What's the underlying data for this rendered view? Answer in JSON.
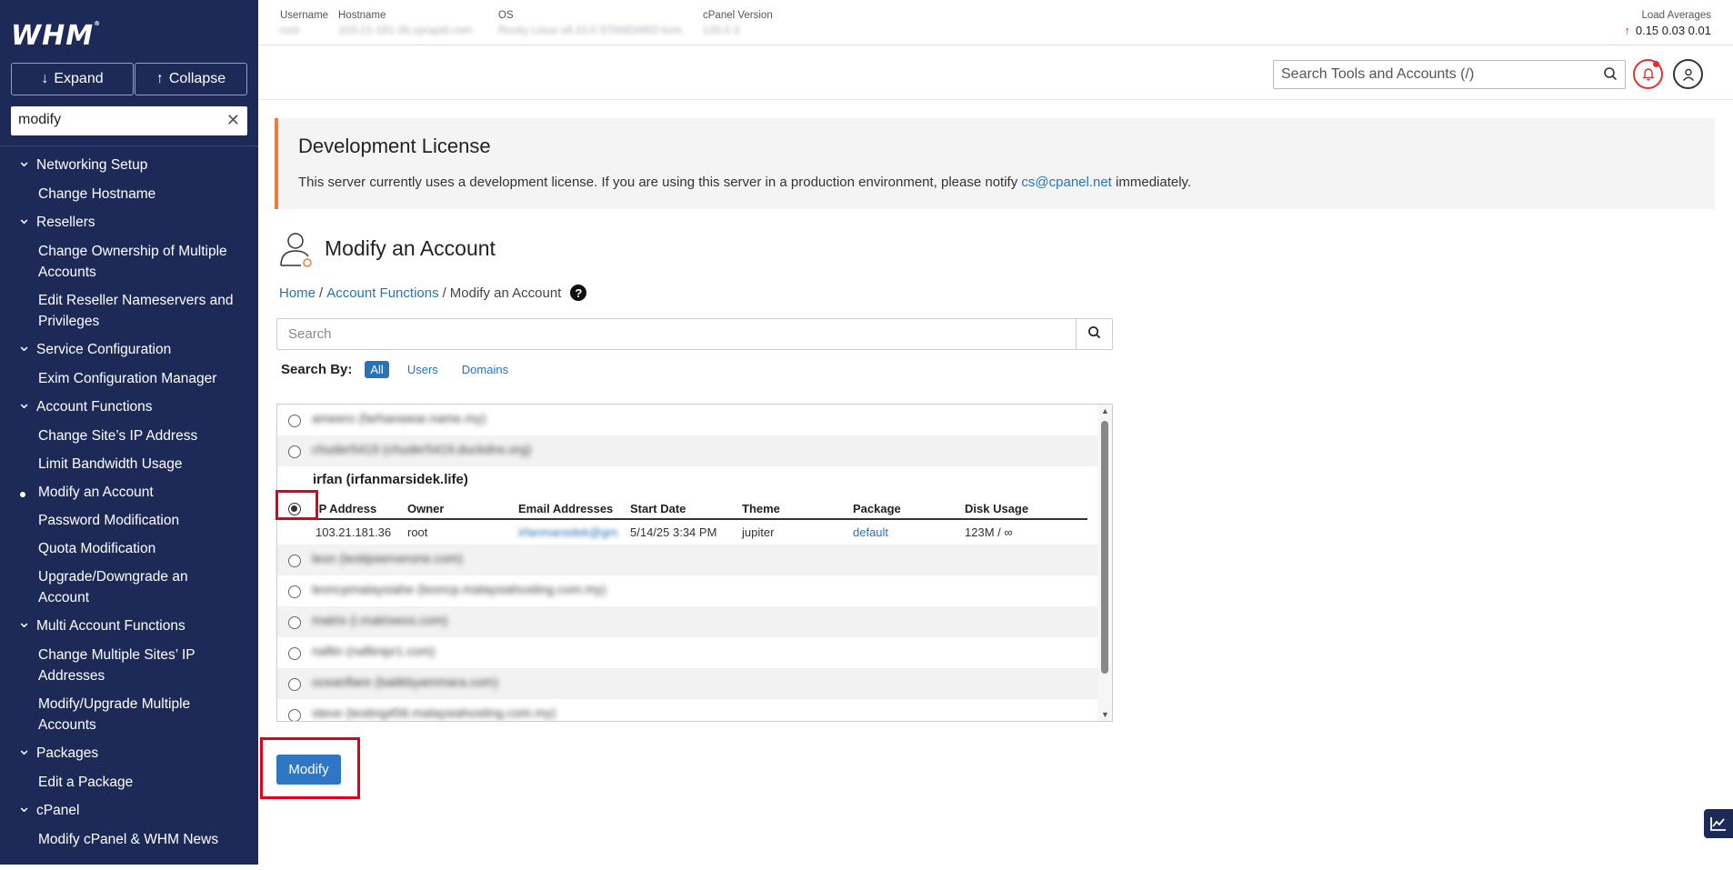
{
  "sidebar": {
    "logo": "WHM",
    "expand_label": "Expand",
    "collapse_label": "Collapse",
    "search_value": "modify",
    "groups": [
      {
        "label": "Networking Setup",
        "items": [
          "Change Hostname"
        ]
      },
      {
        "label": "Resellers",
        "items": [
          "Change Ownership of Multiple Accounts",
          "Edit Reseller Nameservers and Privileges"
        ]
      },
      {
        "label": "Service Configuration",
        "items": [
          "Exim Configuration Manager"
        ]
      },
      {
        "label": "Account Functions",
        "items": [
          "Change Site’s IP Address",
          "Limit Bandwidth Usage",
          "Modify an Account",
          "Password Modification",
          "Quota Modification",
          "Upgrade/Downgrade an Account"
        ]
      },
      {
        "label": "Multi Account Functions",
        "items": [
          "Change Multiple Sites’ IP Addresses",
          "Modify/Upgrade Multiple Accounts"
        ]
      },
      {
        "label": "Packages",
        "items": [
          "Edit a Package"
        ]
      },
      {
        "label": "cPanel",
        "items": [
          "Modify cPanel & WHM News"
        ]
      }
    ],
    "active_item": "Modify an Account"
  },
  "topbar": {
    "username_label": "Username",
    "username_value": "root",
    "hostname_label": "Hostname",
    "hostname_value": "103-21-181-36.cprapid.com",
    "os_label": "OS",
    "os_value": "Rocky Linux v8.10.0 STANDARD kvm",
    "cpanel_label": "cPanel Version",
    "cpanel_value": "130.0.3",
    "load_label": "Load Averages",
    "load_values": "0.15  0.03  0.01"
  },
  "header": {
    "search_placeholder": "Search Tools and Accounts (/)"
  },
  "license": {
    "title": "Development License",
    "text_before": "This server currently uses a development license. If you are using this server in a production environment, please notify ",
    "email": "cs@cpanel.net",
    "text_after": " immediately."
  },
  "page": {
    "title": "Modify an Account",
    "breadcrumb_home": "Home",
    "breadcrumb_section": "Account Functions",
    "breadcrumb_current": "Modify an Account",
    "search_placeholder": "Search",
    "search_by_label": "Search By:",
    "search_by_options": [
      "All",
      "Users",
      "Domains"
    ],
    "modify_label": "Modify"
  },
  "accounts": {
    "above": [
      "ameero (farhanwear.name.my)",
      "chuder5419 (chuder5419.duckdns.org)"
    ],
    "selected": {
      "title": "irfan (irfanmarsidek.life)",
      "headers": [
        "IP Address",
        "Owner",
        "Email Addresses",
        "Start Date",
        "Theme",
        "Package",
        "Disk Usage"
      ],
      "values": [
        "103.21.181.36",
        "root",
        "irfanmarsidek@gm",
        "5/14/25 3:34 PM",
        "jupiter",
        "default",
        "123M / ∞"
      ]
    },
    "below": [
      "leon (testipserverone.com)",
      "leoncpmalaysiahe (leoncp.malaysiahosting.com.my)",
      "matrix (i.matrixeos.com)",
      "naftin (naftinipr1.com)",
      "oceanflare (baitkbyammara.com)",
      "steve (testing456.malaysiahosting.com.my)"
    ]
  },
  "colors": {
    "sidebar_bg": "#1d2a57",
    "accent": "#2f77c4",
    "highlight": "#e0001b",
    "license_border": "#f07a3c"
  }
}
